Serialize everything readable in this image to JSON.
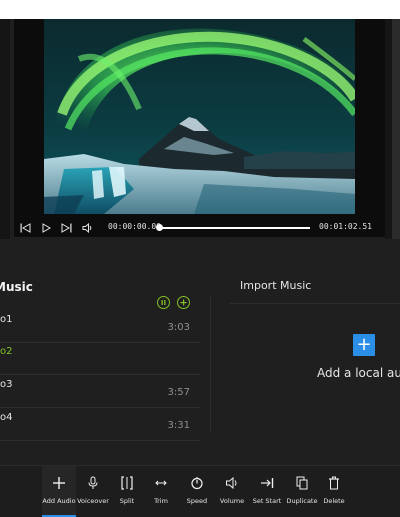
{
  "player": {
    "current_time": "00:00:00.00",
    "total_time": "00:01:02.51",
    "progress_fraction": 0.0,
    "icons": [
      "previous-frame-icon",
      "play-icon",
      "next-frame-icon",
      "volume-icon"
    ]
  },
  "music_panel": {
    "title": "Music",
    "tracks": [
      {
        "name": "o1",
        "duration": "3:03"
      },
      {
        "name": "o2",
        "duration": ""
      },
      {
        "name": "o3",
        "duration": "3:57"
      },
      {
        "name": "o4",
        "duration": "3:31"
      }
    ],
    "active_track_index": 1
  },
  "import_panel": {
    "title": "Import Music",
    "add_local_label": "Add a local au",
    "accent": "#2b8fe8"
  },
  "toolbar": {
    "items": [
      {
        "label": "Add Audio",
        "icon": "plus-icon"
      },
      {
        "label": "Voiceover",
        "icon": "microphone-icon"
      },
      {
        "label": "Split",
        "icon": "split-icon"
      },
      {
        "label": "Trim",
        "icon": "trim-icon"
      },
      {
        "label": "Speed",
        "icon": "speed-icon"
      },
      {
        "label": "Volume",
        "icon": "volume-icon"
      },
      {
        "label": "Set Start",
        "icon": "set-start-icon"
      },
      {
        "label": "Duplicate",
        "icon": "duplicate-icon"
      },
      {
        "label": "Delete",
        "icon": "delete-icon"
      }
    ],
    "active_index": 0
  },
  "colors": {
    "active_green": "#84c324",
    "accent_blue": "#2b8fe8",
    "background": "#1f1f1f"
  }
}
